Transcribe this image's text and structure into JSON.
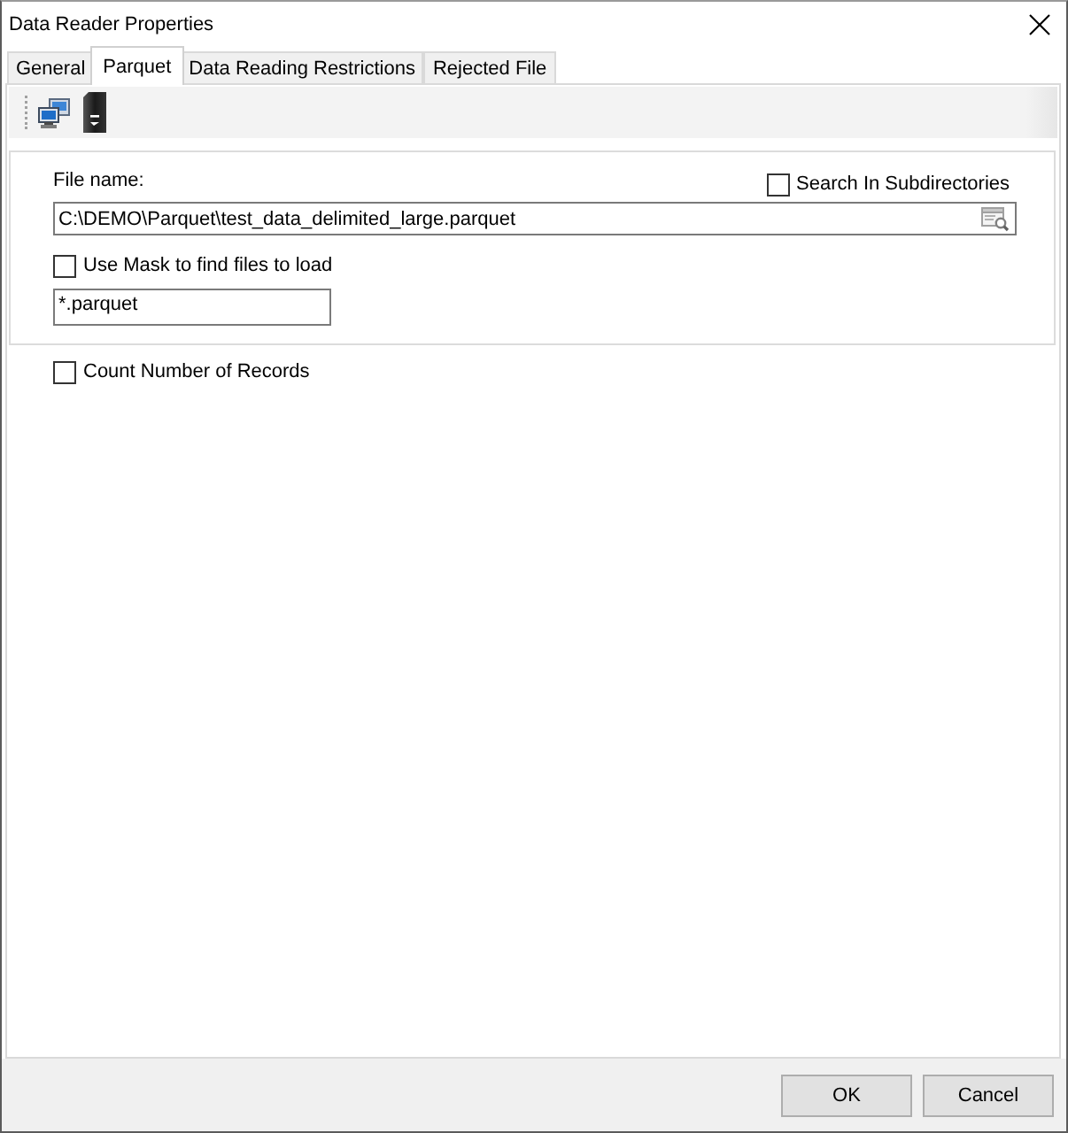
{
  "window": {
    "title": "Data Reader Properties"
  },
  "tabs": [
    {
      "label": "General",
      "selected": false
    },
    {
      "label": "Parquet",
      "selected": true
    },
    {
      "label": "Data Reading Restrictions",
      "selected": false
    },
    {
      "label": "Rejected File",
      "selected": false
    }
  ],
  "file": {
    "label": "File name:",
    "value": "C:\\DEMO\\Parquet\\test_data_delimited_large.parquet"
  },
  "search_subdirectories": {
    "label": "Search In Subdirectories",
    "checked": false
  },
  "use_mask": {
    "label": "Use Mask to find files to load",
    "checked": false
  },
  "mask": {
    "value": "*.parquet"
  },
  "count_records": {
    "label": "Count Number of Records",
    "checked": false
  },
  "buttons": [
    {
      "label": "OK"
    },
    {
      "label": "Cancel"
    }
  ]
}
